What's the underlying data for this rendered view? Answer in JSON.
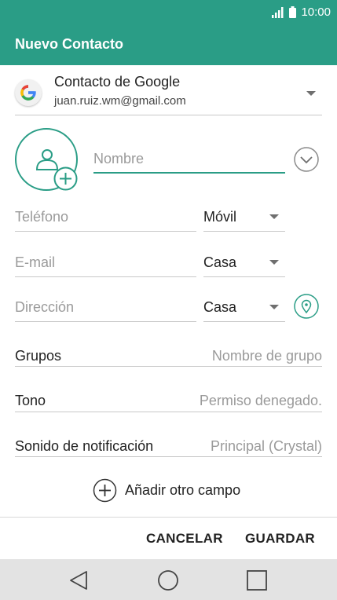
{
  "status_bar": {
    "time": "10:00"
  },
  "header": {
    "title": "Nuevo Contacto"
  },
  "account": {
    "title": "Contacto de Google",
    "email": "juan.ruiz.wm@gmail.com"
  },
  "name_field": {
    "placeholder": "Nombre"
  },
  "phone": {
    "placeholder": "Teléfono",
    "type": "Móvil"
  },
  "email": {
    "placeholder": "E-mail",
    "type": "Casa"
  },
  "address": {
    "placeholder": "Dirección",
    "type": "Casa"
  },
  "groups": {
    "label": "Grupos",
    "value": "Nombre de grupo"
  },
  "ringtone": {
    "label": "Tono",
    "value": "Permiso denegado."
  },
  "notification": {
    "label": "Sonido de notificación",
    "value": "Principal (Crystal)"
  },
  "add_field": {
    "label": "Añadir otro campo"
  },
  "actions": {
    "cancel": "CANCELAR",
    "save": "GUARDAR"
  },
  "colors": {
    "accent": "#2a9d86",
    "nav_bar": "#e3e3e3"
  }
}
